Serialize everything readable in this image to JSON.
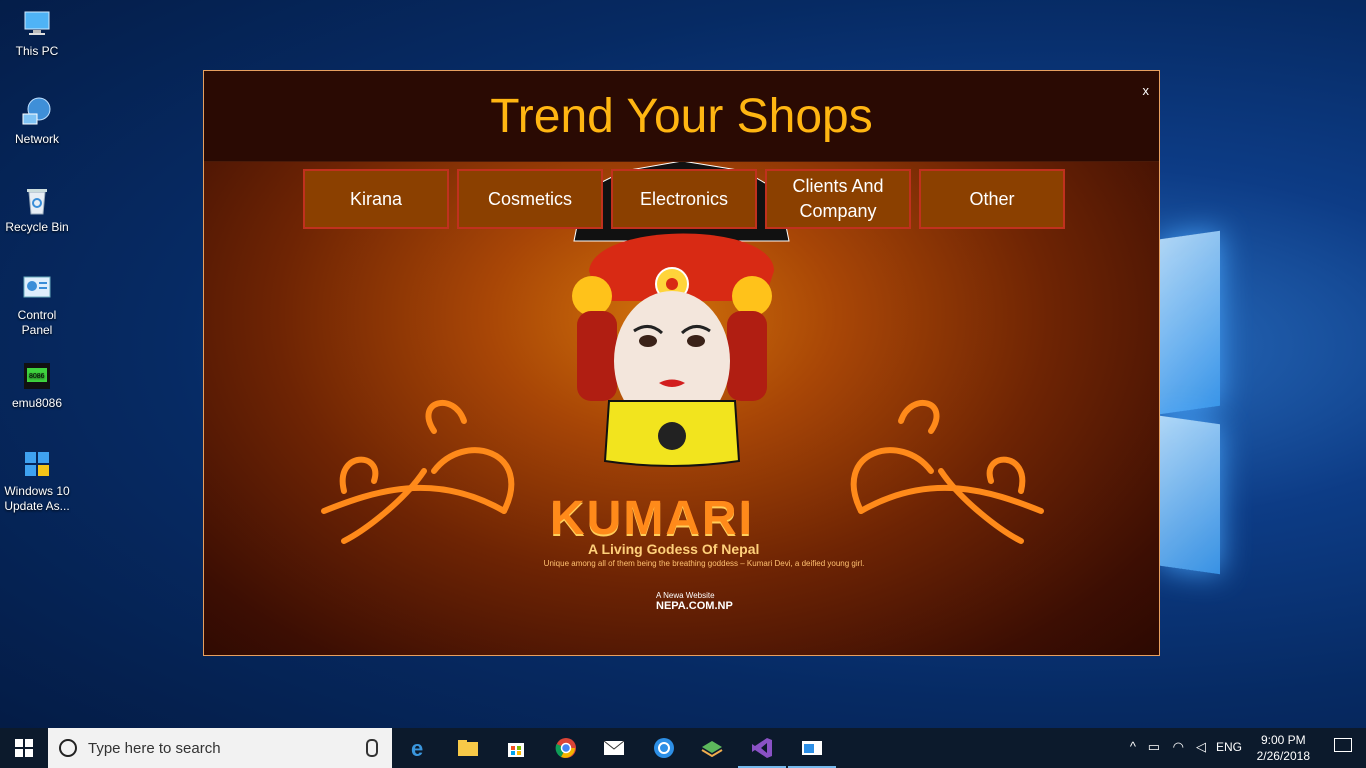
{
  "desktop": {
    "icons": [
      {
        "label": "This PC"
      },
      {
        "label": "Network"
      },
      {
        "label": "Recycle Bin"
      },
      {
        "label": "Control Panel"
      },
      {
        "label": "emu8086"
      },
      {
        "label": "Windows 10 Update As..."
      }
    ]
  },
  "app": {
    "title": "Trend Your Shops",
    "close_label": "x",
    "nav": [
      {
        "label": "Kirana"
      },
      {
        "label": "Cosmetics"
      },
      {
        "label": "Electronics"
      },
      {
        "label": "Clients And Company"
      },
      {
        "label": "Other"
      }
    ],
    "banner": {
      "heading": "KUMARI",
      "subtitle": "A Living Godess Of Nepal",
      "tagline": "Unique among all of them being the  breathing goddess – Kumari Devi, a deified young girl.",
      "credit_small": "A Newa Website",
      "credit_site": "NEPA.COM.NP"
    }
  },
  "taskbar": {
    "search_placeholder": "Type here to search",
    "apps": [
      "edge-icon",
      "file-explorer-icon",
      "store-icon",
      "chrome-icon",
      "mail-icon",
      "sync-icon",
      "layers-icon",
      "visual-studio-icon",
      "app-window-icon"
    ],
    "language": "ENG",
    "time": "9:00 PM",
    "date": "2/26/2018"
  },
  "colors": {
    "title": "#ffb612",
    "nav_bg": "#8b4000",
    "nav_border": "#c0311e"
  }
}
